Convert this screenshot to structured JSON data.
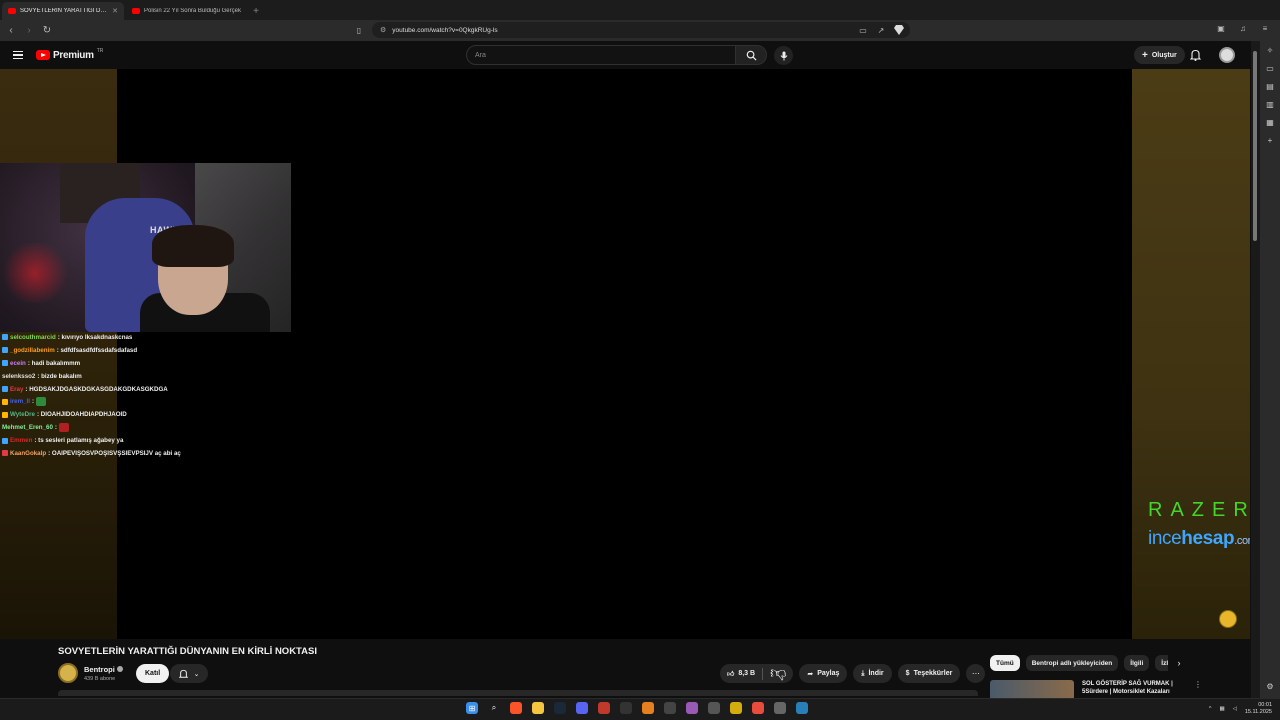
{
  "browser": {
    "tabs": [
      {
        "title": "SOVYETLERİN YARATTIĞI DÜNYANIN",
        "active": true
      },
      {
        "title": "Polisin 22 Yıl Sonra Bulduğu Gerçek",
        "active": false
      }
    ],
    "new_tab": "+",
    "url": "youtube.com/watch?v=0QkgkRUg-ls"
  },
  "youtube": {
    "logo_text": "Premium",
    "region": "TR",
    "search_placeholder": "Ara",
    "create_label": "Oluştur"
  },
  "chat": [
    {
      "user": "selcouthmarcid",
      "color": "#7ed957",
      "msg": ": kıvırıyo lksakdnaskcnas",
      "badge": "#3ea6ff"
    },
    {
      "user": "_godzillabenim",
      "color": "#ff9f1c",
      "msg": ": sdfdfsasdfdfssdafsdafasd",
      "badge": "#3ea6ff"
    },
    {
      "user": "ecein",
      "color": "#c77dff",
      "msg": ": hadi bakalımmm",
      "badge": "#3ea6ff"
    },
    {
      "user": "selenksso2",
      "color": "#e0e0e0",
      "msg": ": bizde bakalım",
      "badge": ""
    },
    {
      "user": "Eray",
      "color": "#e63946",
      "msg": ": HGDSAKJDGASKDGKASGDAKGDKASGKDGA",
      "badge": "#3ea6ff"
    },
    {
      "user": "irem_ll",
      "color": "#4361ee",
      "msg": ":",
      "badge": "#ffb703",
      "emote": "green"
    },
    {
      "user": "WyteDre",
      "color": "#52b788",
      "msg": ": DIOAHJIDOAHDIAPDHJAOID",
      "badge": "#ffb703"
    },
    {
      "user": "Mehmet_Eren_60",
      "color": "#80ed99",
      "msg": ":",
      "badge": "",
      "emote": "red"
    },
    {
      "user": "Emmen",
      "color": "#d62828",
      "msg": ": ts sesleri patlamış ağabey ya",
      "badge": "#3ea6ff"
    },
    {
      "user": "KaanGokalp",
      "color": "#f4a261",
      "msg": ": OAIPEVIŞOSVPOŞISVŞSIEVPSIJV aç abi aç",
      "badge": "#e63946"
    }
  ],
  "overlay": {
    "razer": "RAZER",
    "incehesap_a": "ince",
    "incehesap_b": "hesap",
    "incehesap_c": ".com",
    "webcam_chair_text": "HAWK"
  },
  "video": {
    "title": "SOVYETLERİN YARATTIĞI DÜNYANIN EN KİRLİ NOKTASI",
    "channel": "Bentropi",
    "subscribers": "439 B abone",
    "join": "Katıl",
    "likes": "8,3 B",
    "share": "Paylaş",
    "download": "İndir",
    "thanks": "Teşekkürler"
  },
  "chips": [
    "Tümü",
    "Bentropi adlı yükleyiciden",
    "İlgili",
    "İzle"
  ],
  "reco": {
    "title": "SOL GÖSTERİP SAĞ VURMAK | 5Sürdere | Motorsiklet Kazaları"
  },
  "tray": {
    "time": "00:01",
    "date": "15.11.2025"
  }
}
